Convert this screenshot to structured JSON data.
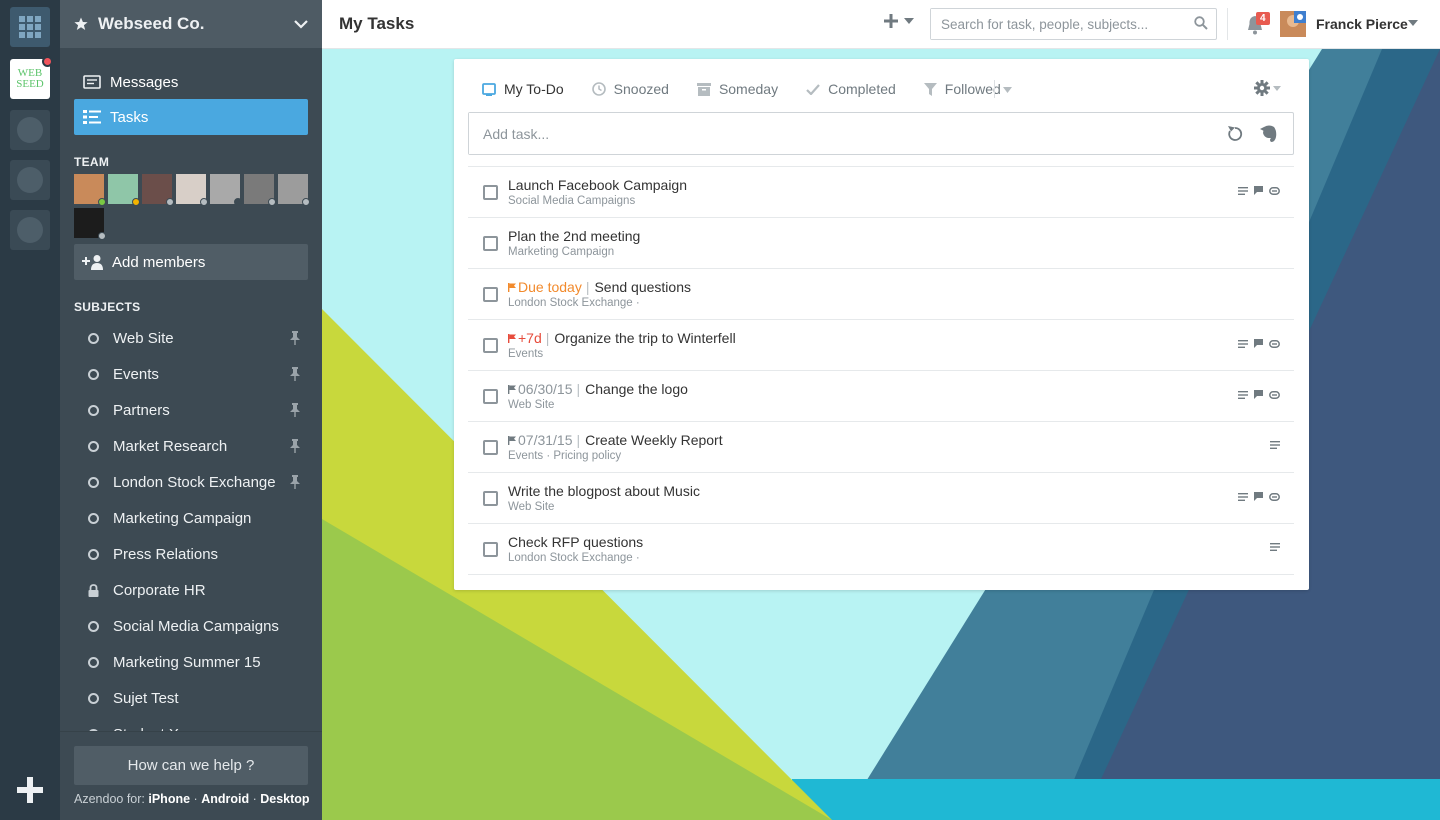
{
  "app": {
    "workspace_name": "Webseed Co.",
    "workspace_logo_text": [
      "WEB",
      "SEED"
    ],
    "colors": {
      "accent": "#4aa8e0",
      "sidebar": "#3d4a53",
      "rail": "#2b3a45",
      "due_today": "#f28a2c",
      "overdue": "#e74c3c"
    }
  },
  "sidebar": {
    "nav": [
      {
        "label": "Messages",
        "icon": "message-icon"
      },
      {
        "label": "Tasks",
        "icon": "tasks-icon",
        "active": true
      }
    ],
    "team_title": "TEAM",
    "add_members_label": "Add members",
    "subjects_title": "SUBJECTS",
    "subjects": [
      {
        "label": "Web Site",
        "pinned": true,
        "type": "open"
      },
      {
        "label": "Events",
        "pinned": true,
        "type": "open"
      },
      {
        "label": "Partners",
        "pinned": true,
        "type": "open"
      },
      {
        "label": "Market Research",
        "pinned": true,
        "type": "open"
      },
      {
        "label": "London Stock Exchange",
        "pinned": true,
        "type": "open"
      },
      {
        "label": "Marketing Campaign",
        "pinned": false,
        "type": "open"
      },
      {
        "label": "Press Relations",
        "pinned": false,
        "type": "open"
      },
      {
        "label": "Corporate HR",
        "pinned": false,
        "type": "private"
      },
      {
        "label": "Social Media Campaigns",
        "pinned": false,
        "type": "open"
      },
      {
        "label": "Marketing Summer 15",
        "pinned": false,
        "type": "open"
      },
      {
        "label": "Sujet Test",
        "pinned": false,
        "type": "open"
      },
      {
        "label": "Student X",
        "pinned": false,
        "type": "open"
      }
    ],
    "help_label": "How can we help ?",
    "footer": {
      "prefix": "Azendoo for:",
      "links": [
        "iPhone",
        "Android",
        "Desktop"
      ],
      "separator": "·"
    }
  },
  "topbar": {
    "title": "My Tasks",
    "search_placeholder": "Search for task, people, subjects...",
    "notification_count": "4",
    "user_name": "Franck Pierce"
  },
  "tabs": [
    {
      "label": "My To-Do",
      "icon": "inbox-icon",
      "active": true
    },
    {
      "label": "Snoozed",
      "icon": "clock-icon",
      "active": false
    },
    {
      "label": "Someday",
      "icon": "archive-icon",
      "active": false
    },
    {
      "label": "Completed",
      "icon": "check-icon",
      "active": false
    },
    {
      "label": "Followed",
      "icon": "filter-icon",
      "active": false
    }
  ],
  "add_task_placeholder": "Add task...",
  "tasks": [
    {
      "title": "Launch Facebook Campaign",
      "subject": "Social Media Campaigns",
      "due": "",
      "due_kind": "",
      "meta": [
        "note",
        "comment",
        "attachment"
      ]
    },
    {
      "title": "Plan the 2nd meeting",
      "subject": "Marketing Campaign",
      "due": "",
      "due_kind": "",
      "meta": []
    },
    {
      "title": "Send questions",
      "subject": "London Stock Exchange ·",
      "due": "Due today",
      "due_kind": "today",
      "meta": []
    },
    {
      "title": "Organize the trip to Winterfell",
      "subject": "Events",
      "due": "+7d",
      "due_kind": "overdue",
      "meta": [
        "note",
        "comment",
        "attachment"
      ]
    },
    {
      "title": "Change the logo",
      "subject": "Web Site",
      "due": "06/30/15",
      "due_kind": "date",
      "meta": [
        "note",
        "comment",
        "attachment"
      ]
    },
    {
      "title": "Create Weekly Report",
      "subject": "Events · Pricing policy",
      "due": "07/31/15",
      "due_kind": "date",
      "meta": [
        "note"
      ]
    },
    {
      "title": "Write the blogpost about Music",
      "subject": "Web Site",
      "due": "",
      "due_kind": "",
      "meta": [
        "note",
        "comment",
        "attachment"
      ]
    },
    {
      "title": "Check RFP questions",
      "subject": "London Stock Exchange ·",
      "due": "",
      "due_kind": "",
      "meta": [
        "note"
      ]
    }
  ]
}
